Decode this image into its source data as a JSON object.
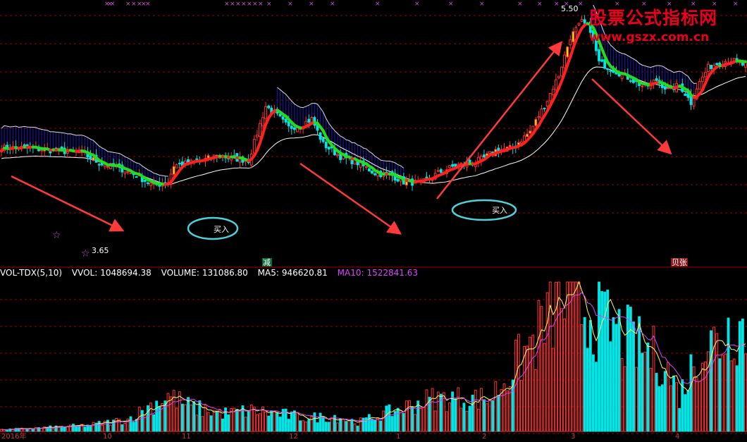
{
  "watermark": {
    "line1": "股票公式指标网",
    "line2": "www.gszx.com.cn"
  },
  "colors": {
    "up": "#ff3333",
    "down": "#00e5e5",
    "ma_up": "#ff2020",
    "ma_down": "#22dd22",
    "band_fill": "#1a1aa8",
    "support": "#ffffff",
    "grid": "#a00000",
    "arrow": "#ff3a3a",
    "circle": "#4fd1d9",
    "marker_x": "#cc55cc",
    "ma5": "#ffff66",
    "ma10": "#dd44ff"
  },
  "price_panel": {
    "high_label": "5.50",
    "low_label": "3.65",
    "annotations": [
      "买入",
      "买入"
    ],
    "signals": [
      "减",
      "贝张"
    ],
    "ylim": [
      3.55,
      5.55
    ]
  },
  "volume_panel": {
    "indicator": "VOL-TDX(5,10)",
    "fields": [
      {
        "label": "VVOL:",
        "value": "1048694.38"
      },
      {
        "label": "VOLUME:",
        "value": "131086.80"
      },
      {
        "label": "MA5:",
        "value": "946620.81"
      },
      {
        "label": "MA10:",
        "value": "1522841.63"
      }
    ],
    "date_labels": [
      "2016年",
      "10",
      "11",
      "12",
      "1",
      "2",
      "3",
      "4"
    ]
  },
  "chart_data": {
    "type": "candlestick",
    "close_path": [
      [
        0,
        4.42
      ],
      [
        8,
        4.42
      ],
      [
        18,
        4.4
      ],
      [
        28,
        4.38
      ],
      [
        34,
        4.3
      ],
      [
        42,
        4.25
      ],
      [
        47,
        4.2
      ],
      [
        53,
        4.12
      ],
      [
        58,
        4.15
      ],
      [
        60,
        4.28
      ],
      [
        65,
        4.3
      ],
      [
        70,
        4.32
      ],
      [
        75,
        4.36
      ],
      [
        80,
        4.34
      ],
      [
        86,
        4.32
      ],
      [
        92,
        4.75
      ],
      [
        95,
        4.7
      ],
      [
        100,
        4.58
      ],
      [
        104,
        4.6
      ],
      [
        108,
        4.65
      ],
      [
        112,
        4.45
      ],
      [
        118,
        4.35
      ],
      [
        124,
        4.3
      ],
      [
        130,
        4.22
      ],
      [
        136,
        4.2
      ],
      [
        140,
        4.15
      ],
      [
        146,
        4.14
      ],
      [
        152,
        4.22
      ],
      [
        158,
        4.28
      ],
      [
        164,
        4.3
      ],
      [
        168,
        4.34
      ],
      [
        172,
        4.4
      ],
      [
        178,
        4.42
      ],
      [
        184,
        4.55
      ],
      [
        190,
        4.8
      ],
      [
        194,
        5.0
      ],
      [
        198,
        5.3
      ],
      [
        202,
        5.42
      ],
      [
        205,
        5.36
      ],
      [
        208,
        5.1
      ],
      [
        212,
        5.05
      ],
      [
        218,
        4.98
      ],
      [
        224,
        4.9
      ],
      [
        228,
        4.96
      ],
      [
        232,
        4.88
      ],
      [
        236,
        4.92
      ],
      [
        240,
        4.78
      ],
      [
        242,
        4.9
      ],
      [
        246,
        5.06
      ],
      [
        250,
        5.1
      ],
      [
        254,
        5.12
      ],
      [
        258,
        5.08
      ]
    ],
    "volume_path": [
      [
        0,
        1
      ],
      [
        30,
        4
      ],
      [
        44,
        8
      ],
      [
        58,
        24
      ],
      [
        66,
        16
      ],
      [
        78,
        12
      ],
      [
        88,
        14
      ],
      [
        106,
        9
      ],
      [
        116,
        10
      ],
      [
        124,
        6
      ],
      [
        150,
        22
      ],
      [
        170,
        22
      ],
      [
        186,
        62
      ],
      [
        194,
        88
      ],
      [
        200,
        86
      ],
      [
        210,
        72
      ],
      [
        222,
        56
      ],
      [
        230,
        48
      ],
      [
        236,
        24
      ],
      [
        244,
        58
      ],
      [
        250,
        60
      ],
      [
        254,
        70
      ]
    ]
  }
}
